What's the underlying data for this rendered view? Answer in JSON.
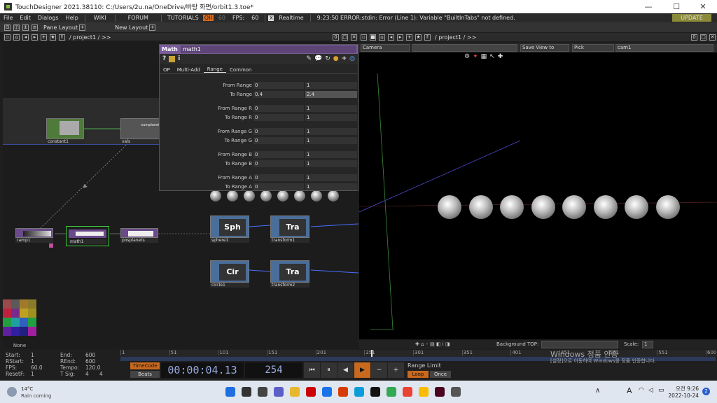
{
  "window": {
    "title": "TouchDesigner 2021.38110: C:/Users/2u.na/OneDrive/바탕 화면/orbit1.3.toe*"
  },
  "menu": {
    "items": [
      "File",
      "Edit",
      "Dialogs",
      "Help"
    ],
    "wiki": "WIKI",
    "forum": "FORUM",
    "tutorials": "TUTORIALS",
    "oii": "OII",
    "fps_small": "60",
    "fps_label": "FPS:",
    "fps_value": "60",
    "realtime_x": "X",
    "realtime": "Realtime",
    "error": "9:23:50 ERROR:stdin: Error (Line 1): Variable \"BuiltInTabs\" not defined.",
    "update": "UPDATE"
  },
  "panebar": {
    "pane_layout": "Pane Layout",
    "new_layout": "New Layout"
  },
  "pathbar": {
    "left_path": "/ project1 / >>",
    "right_path": "/ project1 / >>",
    "left_count": "0",
    "right_count": "0"
  },
  "params": {
    "op_type": "Math",
    "op_name": "math1",
    "info": "i",
    "tabs": [
      "OP",
      "Multi-Add",
      "Range",
      "Common"
    ],
    "rows": [
      {
        "label": "From Range",
        "v1": "0",
        "v2": "1"
      },
      {
        "label": "To Range",
        "v1": "0.4",
        "v2": "2.4"
      },
      {
        "label": "From Range R",
        "v1": "0",
        "v2": "1"
      },
      {
        "label": "To Range R",
        "v1": "0",
        "v2": "1"
      },
      {
        "label": "From Range G",
        "v1": "0",
        "v2": "1"
      },
      {
        "label": "To Range G",
        "v1": "0",
        "v2": "1"
      },
      {
        "label": "From Range B",
        "v1": "0",
        "v2": "1"
      },
      {
        "label": "To Range B",
        "v1": "0",
        "v2": "1"
      },
      {
        "label": "From Range A",
        "v1": "0",
        "v2": "1"
      },
      {
        "label": "To Range A",
        "v1": "0",
        "v2": "1"
      }
    ]
  },
  "nodes": {
    "constant": "constant1",
    "vals": "vals",
    "vals_mid": "numplanet",
    "ramp": "ramp1",
    "math": "math1",
    "posplanets": "posplanets",
    "sphere": "sphere1",
    "sphere_big": "Sph",
    "transform1": "transform1",
    "transform_big": "Tra",
    "circle": "circle1",
    "circle_big": "Cir",
    "transform2": "transform2",
    "transform2_big": "Tra",
    "swatch_label": "None"
  },
  "viewer": {
    "camera": "Camera",
    "save_view": "Save View to",
    "pick": "Pick",
    "cam": "cam1",
    "bg_label": "Background TOP:",
    "scale_label": "Scale:",
    "scale_value": "1"
  },
  "timeline": {
    "start_label": "Start:",
    "start": "1",
    "end_label": "End:",
    "end": "600",
    "rstart_label": "RStart:",
    "rstart": "1",
    "rend_label": "REnd:",
    "rend": "600",
    "fps_label": "FPS:",
    "fps": "60.0",
    "tempo_label": "Tempo:",
    "tempo": "120.0",
    "resetf_label": "ResetF:",
    "resetf": "1",
    "tsig_label": "T Sig:",
    "tsig1": "4",
    "tsig2": "4",
    "ticks": [
      "1",
      "51",
      "101",
      "151",
      "201",
      "251",
      "301",
      "351",
      "401",
      "451",
      "501",
      "551",
      "600"
    ],
    "timecode_btn": "TimeCode",
    "beats_btn": "Beats",
    "timecode": "00:00:04.13",
    "frame": "254",
    "range_limit": "Range Limit",
    "loop": "Loop",
    "once": "Once",
    "activate": "Windows 정품 인증",
    "activate2": "[설정]으로 이동하여 Windows를 정품 인증합니다."
  },
  "taskbar": {
    "temp": "14°C",
    "weather": "Rain coming",
    "time": "오전 9:26",
    "date": "2022-10-24",
    "lang": "A",
    "badge": "2"
  }
}
